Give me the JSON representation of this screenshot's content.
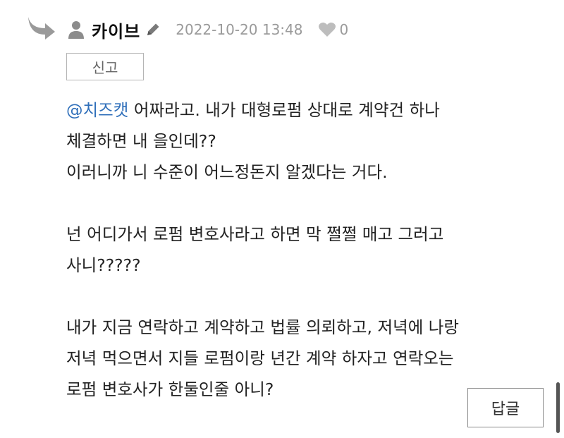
{
  "comment": {
    "author": "카이브",
    "date": "2022-10-20 13:48",
    "likes": "0",
    "report_label": "신고",
    "reply_label": "답글",
    "mention": "@치즈캣",
    "lines": {
      "l1_rest": " 어짜라고. 내가 대형로펌 상대로 계약건 하나",
      "l2": "체결하면 내 을인데??",
      "l3": "이러니까 니 수준이 어느정돈지 알겠다는 거다.",
      "l4": "",
      "l5": "넌 어디가서 로펌 변호사라고 하면 막 쩔쩔 매고 그러고",
      "l6": "사니?????",
      "l7": "",
      "l8": "내가 지금 연락하고 계약하고 법률 의뢰하고, 저녁에 나랑",
      "l9": "저녁 먹으면서 지들 로펌이랑 년간 계약 하자고 연락오는",
      "l10": "로펌 변호사가 한둘인줄 아니?"
    }
  },
  "colors": {
    "text": "#222222",
    "muted": "#9a9a9a",
    "mention": "#2f6fba",
    "icon_gray": "#8c8c8c",
    "border": "#b5b5b5"
  },
  "icons": [
    "reply-arrow-icon",
    "user-icon",
    "pencil-icon",
    "heart-icon"
  ]
}
